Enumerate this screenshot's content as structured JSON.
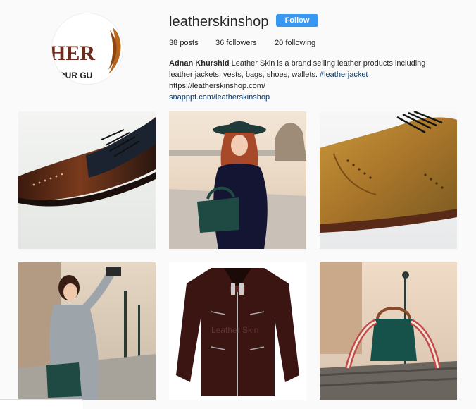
{
  "profile": {
    "username": "leatherskinshop",
    "follow_label": "Follow",
    "posts_count": "38",
    "posts_label": "posts",
    "followers_count": "36",
    "followers_label": "followers",
    "following_count": "20",
    "following_label": "following",
    "avatar_logo_text": "HER",
    "avatar_tagline_text": "S OUR GU",
    "bio": {
      "name": "Adnan Khurshid",
      "text": " Leather Skin is a brand selling leather products including leather jackets, vests, bags, shoes, wallets. ",
      "hashtag": "#leatherjacket",
      "url": " https://leatherskinshop.com/",
      "link": "snapppt.com/leatherskinshop"
    }
  },
  "posts": [
    {
      "subject": "brown-black-wingtip-shoe"
    },
    {
      "subject": "woman-in-hat-with-green-bag"
    },
    {
      "subject": "tan-brogue-shoe"
    },
    {
      "subject": "woman-taking-photo-with-bag"
    },
    {
      "subject": "brown-leather-jacket",
      "watermark": "Leather Skin"
    },
    {
      "subject": "green-bag-on-bench"
    }
  ],
  "colors": {
    "background": "#fafafa",
    "follow_button": "#3897f0",
    "link": "#003569",
    "text": "#262626"
  }
}
